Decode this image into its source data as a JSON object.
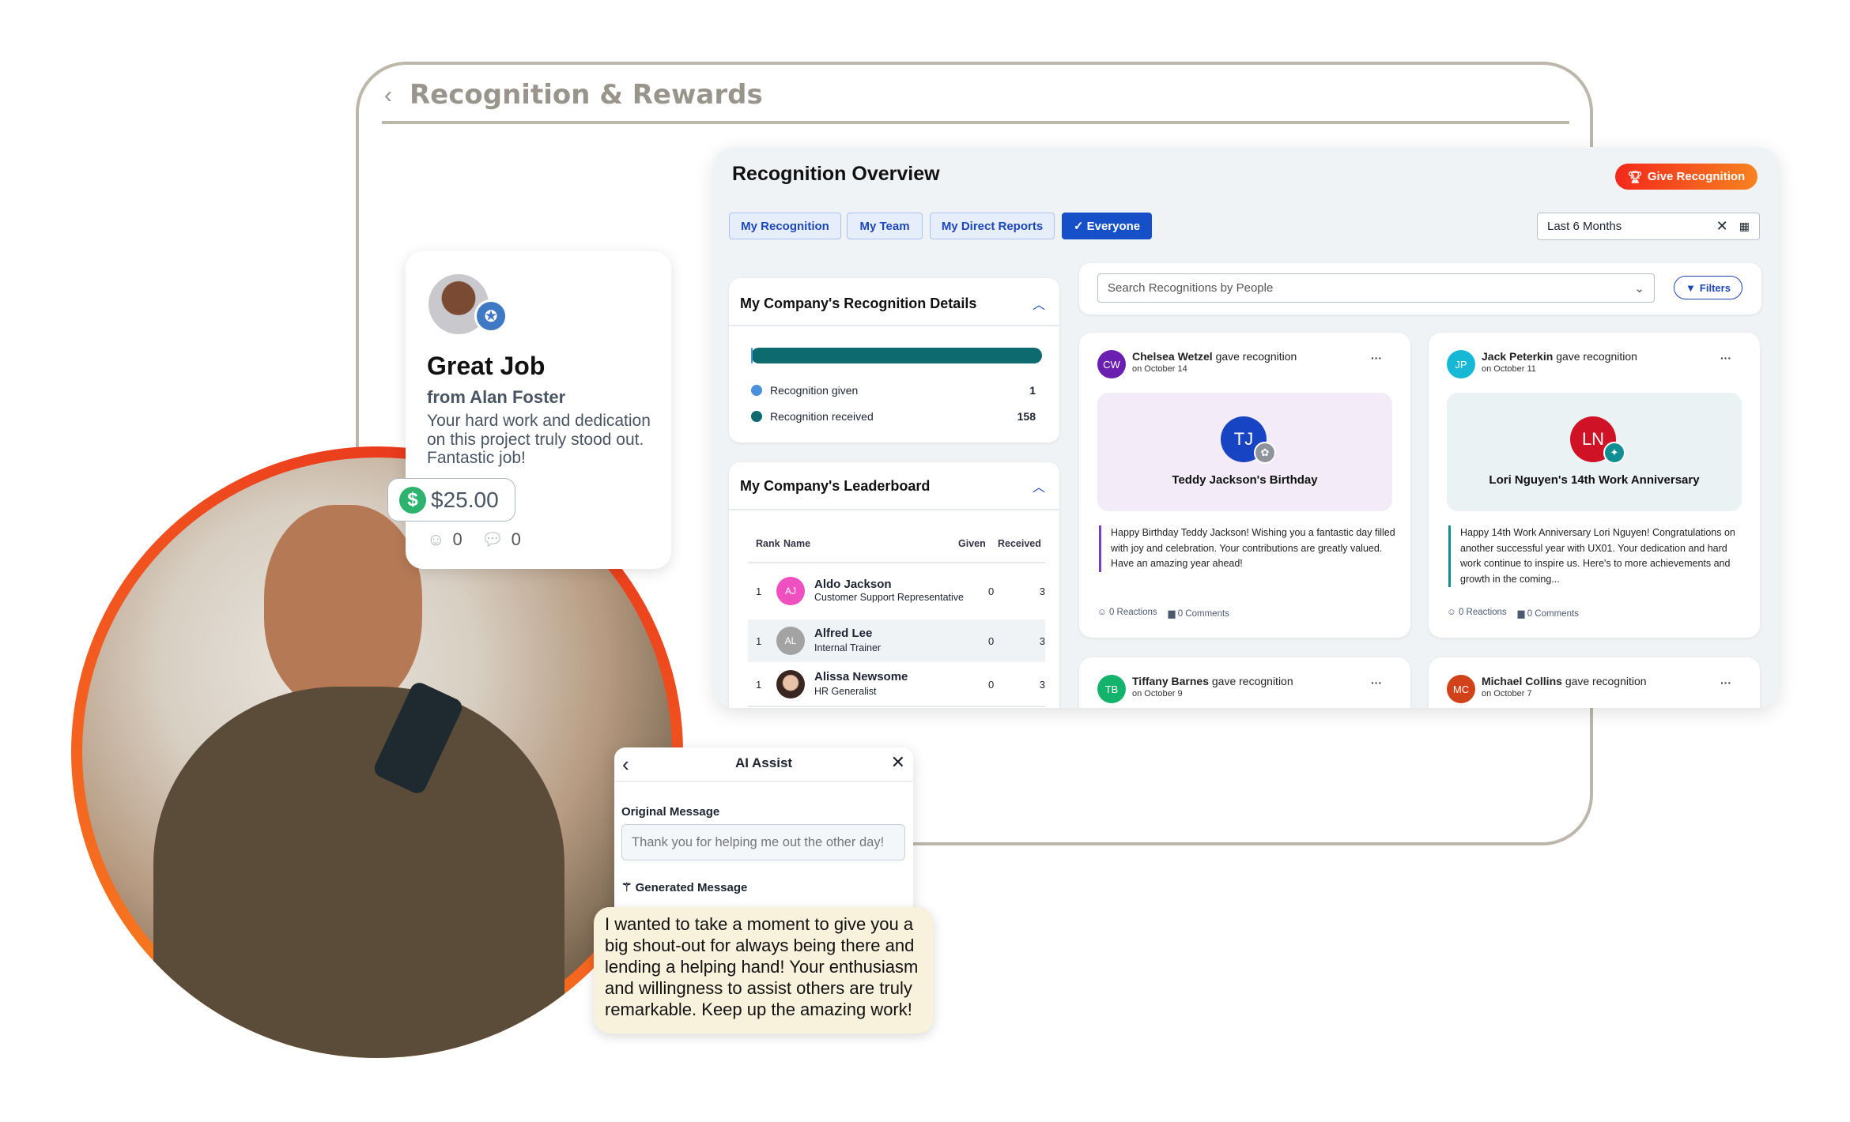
{
  "frame": {
    "title": "Recognition & Rewards"
  },
  "overview": {
    "title": "Recognition Overview",
    "give_button": "Give Recognition",
    "tabs": [
      {
        "label": "My Recognition"
      },
      {
        "label": "My Team"
      },
      {
        "label": "My Direct Reports"
      },
      {
        "label": "✓ Everyone",
        "active": true
      }
    ],
    "date_filter": "Last 6 Months",
    "details": {
      "title": "My Company's Recognition Details",
      "legend": [
        {
          "label": "Recognition given",
          "value": "1",
          "color": "#4a8fdc"
        },
        {
          "label": "Recognition received",
          "value": "158",
          "color": "#0d6b70"
        }
      ]
    },
    "leaderboard": {
      "title": "My Company's Leaderboard",
      "columns": [
        "Rank",
        "Name",
        "Given",
        "Received"
      ],
      "rows": [
        {
          "rank": "1",
          "initials": "AJ",
          "name": "Aldo Jackson",
          "role": "Customer Support Representative",
          "given": "0",
          "received": "3",
          "color": "#f04fc0"
        },
        {
          "rank": "1",
          "initials": "AL",
          "name": "Alfred Lee",
          "role": "Internal Trainer",
          "given": "0",
          "received": "3",
          "color": "#a3a3a3"
        },
        {
          "rank": "1",
          "initials": "",
          "name": "Alissa Newsome",
          "role": "HR Generalist",
          "given": "0",
          "received": "3",
          "color": "#6b4a3a"
        }
      ]
    },
    "search": {
      "placeholder": "Search Recognitions by People",
      "filters_label": "Filters"
    },
    "cards": [
      {
        "initials": "CW",
        "giver": "Chelsea Wetzel",
        "action": "gave recognition",
        "date": "on October 14",
        "color": "#6a1fb0",
        "target_initials": "TJ",
        "target_color": "#1744c2",
        "badge_color": "#8d949c",
        "banner_color": "#f3ecf8",
        "accent": "#7b3fc4",
        "title": "Teddy Jackson's Birthday",
        "message": "Happy Birthday Teddy Jackson! Wishing you a fantastic day filled with joy and celebration. Your contributions are greatly valued. Have an amazing year ahead!",
        "reactions": "0 Reactions",
        "comments": "0 Comments"
      },
      {
        "initials": "JP",
        "giver": "Jack Peterkin",
        "action": "gave recognition",
        "date": "on October 11",
        "color": "#17b7d6",
        "target_initials": "LN",
        "target_color": "#cf1226",
        "badge_color": "#0f8f93",
        "banner_color": "#eaf2f3",
        "accent": "#0f8f93",
        "title": "Lori Nguyen's 14th Work Anniversary",
        "message": "Happy 14th Work Anniversary Lori Nguyen! Congratulations on another successful year with UX01. Your dedication and hard work continue to inspire us. Here's to more achievements and growth in the coming...",
        "reactions": "0 Reactions",
        "comments": "0 Comments"
      },
      {
        "initials": "TB",
        "giver": "Tiffany Barnes",
        "action": "gave recognition",
        "date": "on October 9",
        "color": "#14b36b"
      },
      {
        "initials": "MC",
        "giver": "Michael Collins",
        "action": "gave recognition",
        "date": "on October 7",
        "color": "#d2421a"
      }
    ]
  },
  "great_job": {
    "title": "Great Job",
    "from": "from Alan Foster",
    "message": "Your hard work and dedication on this project truly stood out. Fantastic job!",
    "amount": "$25.00",
    "reactions": "0",
    "comments": "0"
  },
  "ai_assist": {
    "title": "AI Assist",
    "original_label": "Original Message",
    "original_placeholder": "Thank you for helping me out the other day!",
    "generated_label": "Generated Message",
    "generated_text": "I wanted to take a moment to give you a big shout-out for always being there and lending a helping hand! Your enthusiasm and willingness to assist others are truly remarkable. Keep up the amazing work!"
  }
}
